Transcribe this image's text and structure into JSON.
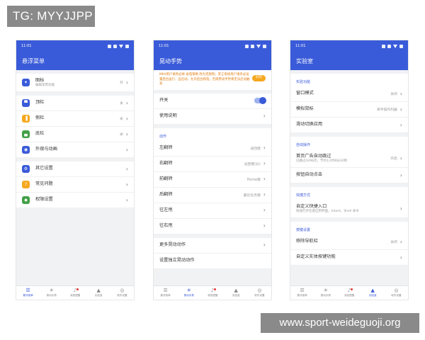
{
  "overlay": {
    "tg_tag": "TG: MYYJJPP",
    "watermark": "www.sport-weideguoji.org"
  },
  "colors": {
    "primary": "#3a5bd9",
    "accent_orange": "#f6a81f",
    "background": "#f1f2f4"
  },
  "status_time": "11:01",
  "bottom_nav": [
    {
      "label": "悬浮菜单",
      "icon": "menu-icon"
    },
    {
      "label": "晃动手势",
      "icon": "gesture-icon"
    },
    {
      "label": "消息提醒",
      "icon": "bell-icon"
    },
    {
      "label": "实验室",
      "icon": "flask-icon"
    },
    {
      "label": "软件设置",
      "icon": "settings-icon"
    }
  ],
  "screen1": {
    "title": "悬浮菜单",
    "icon_row": {
      "label": "图标",
      "sub": "编辑常用功能",
      "value": "开"
    },
    "bar_rows": [
      {
        "label": "顶栏",
        "value": "关",
        "icon": "top-bar-icon",
        "color": "#3a5bd9"
      },
      {
        "label": "侧栏",
        "value": "关",
        "icon": "side-bar-icon",
        "color": "#f6a81f"
      },
      {
        "label": "底栏",
        "value": "关",
        "icon": "bottom-bar-icon",
        "color": "#43a047"
      },
      {
        "label": "外观与动画",
        "value": "",
        "icon": "palette-icon",
        "color": "#3a5bd9"
      }
    ],
    "other_rows": [
      {
        "label": "其它设置",
        "icon": "gear-icon",
        "color": "#3a5bd9"
      },
      {
        "label": "常见问题",
        "icon": "question-icon",
        "color": "#f6a81f"
      },
      {
        "label": "权限设置",
        "icon": "shield-icon",
        "color": "#43a047"
      }
    ]
  },
  "screen2": {
    "title": "晃动手势",
    "notice": "MIUI用户请务必将 省电策略 改为无限制；其它系统用户请务必设置后台运行、自启动、允许后台耗电，否则晃动手势将无法启动触发",
    "notice_btn": "好的",
    "switch_label": "开关",
    "help_label": "使用说明",
    "section_actions": "动作",
    "actions": [
      {
        "label": "左翻转",
        "value": "返回键"
      },
      {
        "label": "右翻转",
        "value": "返回键(长)"
      },
      {
        "label": "前翻转",
        "value": "Home键"
      },
      {
        "label": "后翻转",
        "value": "最近任务键"
      },
      {
        "label": "往左甩",
        "value": ""
      },
      {
        "label": "往右甩",
        "value": ""
      }
    ],
    "more_actions": "更多晃动动作",
    "independent": "设置独立晃动动作"
  },
  "screen3": {
    "title": "实验室",
    "section_lab": "实验功能",
    "lab_rows": [
      {
        "label": "窗口模式",
        "value": "关闭"
      },
      {
        "label": "模拟鼠标",
        "value": "单手操作利器"
      },
      {
        "label": "滑动切换应用",
        "value": ""
      }
    ],
    "section_auto": "自动操作",
    "auto_skip": {
      "label": "首页广告自动跳过",
      "sub": "已跳过3298次，节约1小时8分30秒",
      "value": "开启"
    },
    "auto_click": "按钮自动点击",
    "section_shortcut": "快捷方式",
    "shortcut": {
      "label": "自定义快捷入口",
      "sub": "快速打开任意应用界面，Intent、Shell 命令"
    },
    "section_key": "按键设置",
    "key_rows": [
      {
        "label": "移除导航栏",
        "value": "关闭"
      },
      {
        "label": "自定义实体按键功能",
        "value": ""
      }
    ]
  }
}
